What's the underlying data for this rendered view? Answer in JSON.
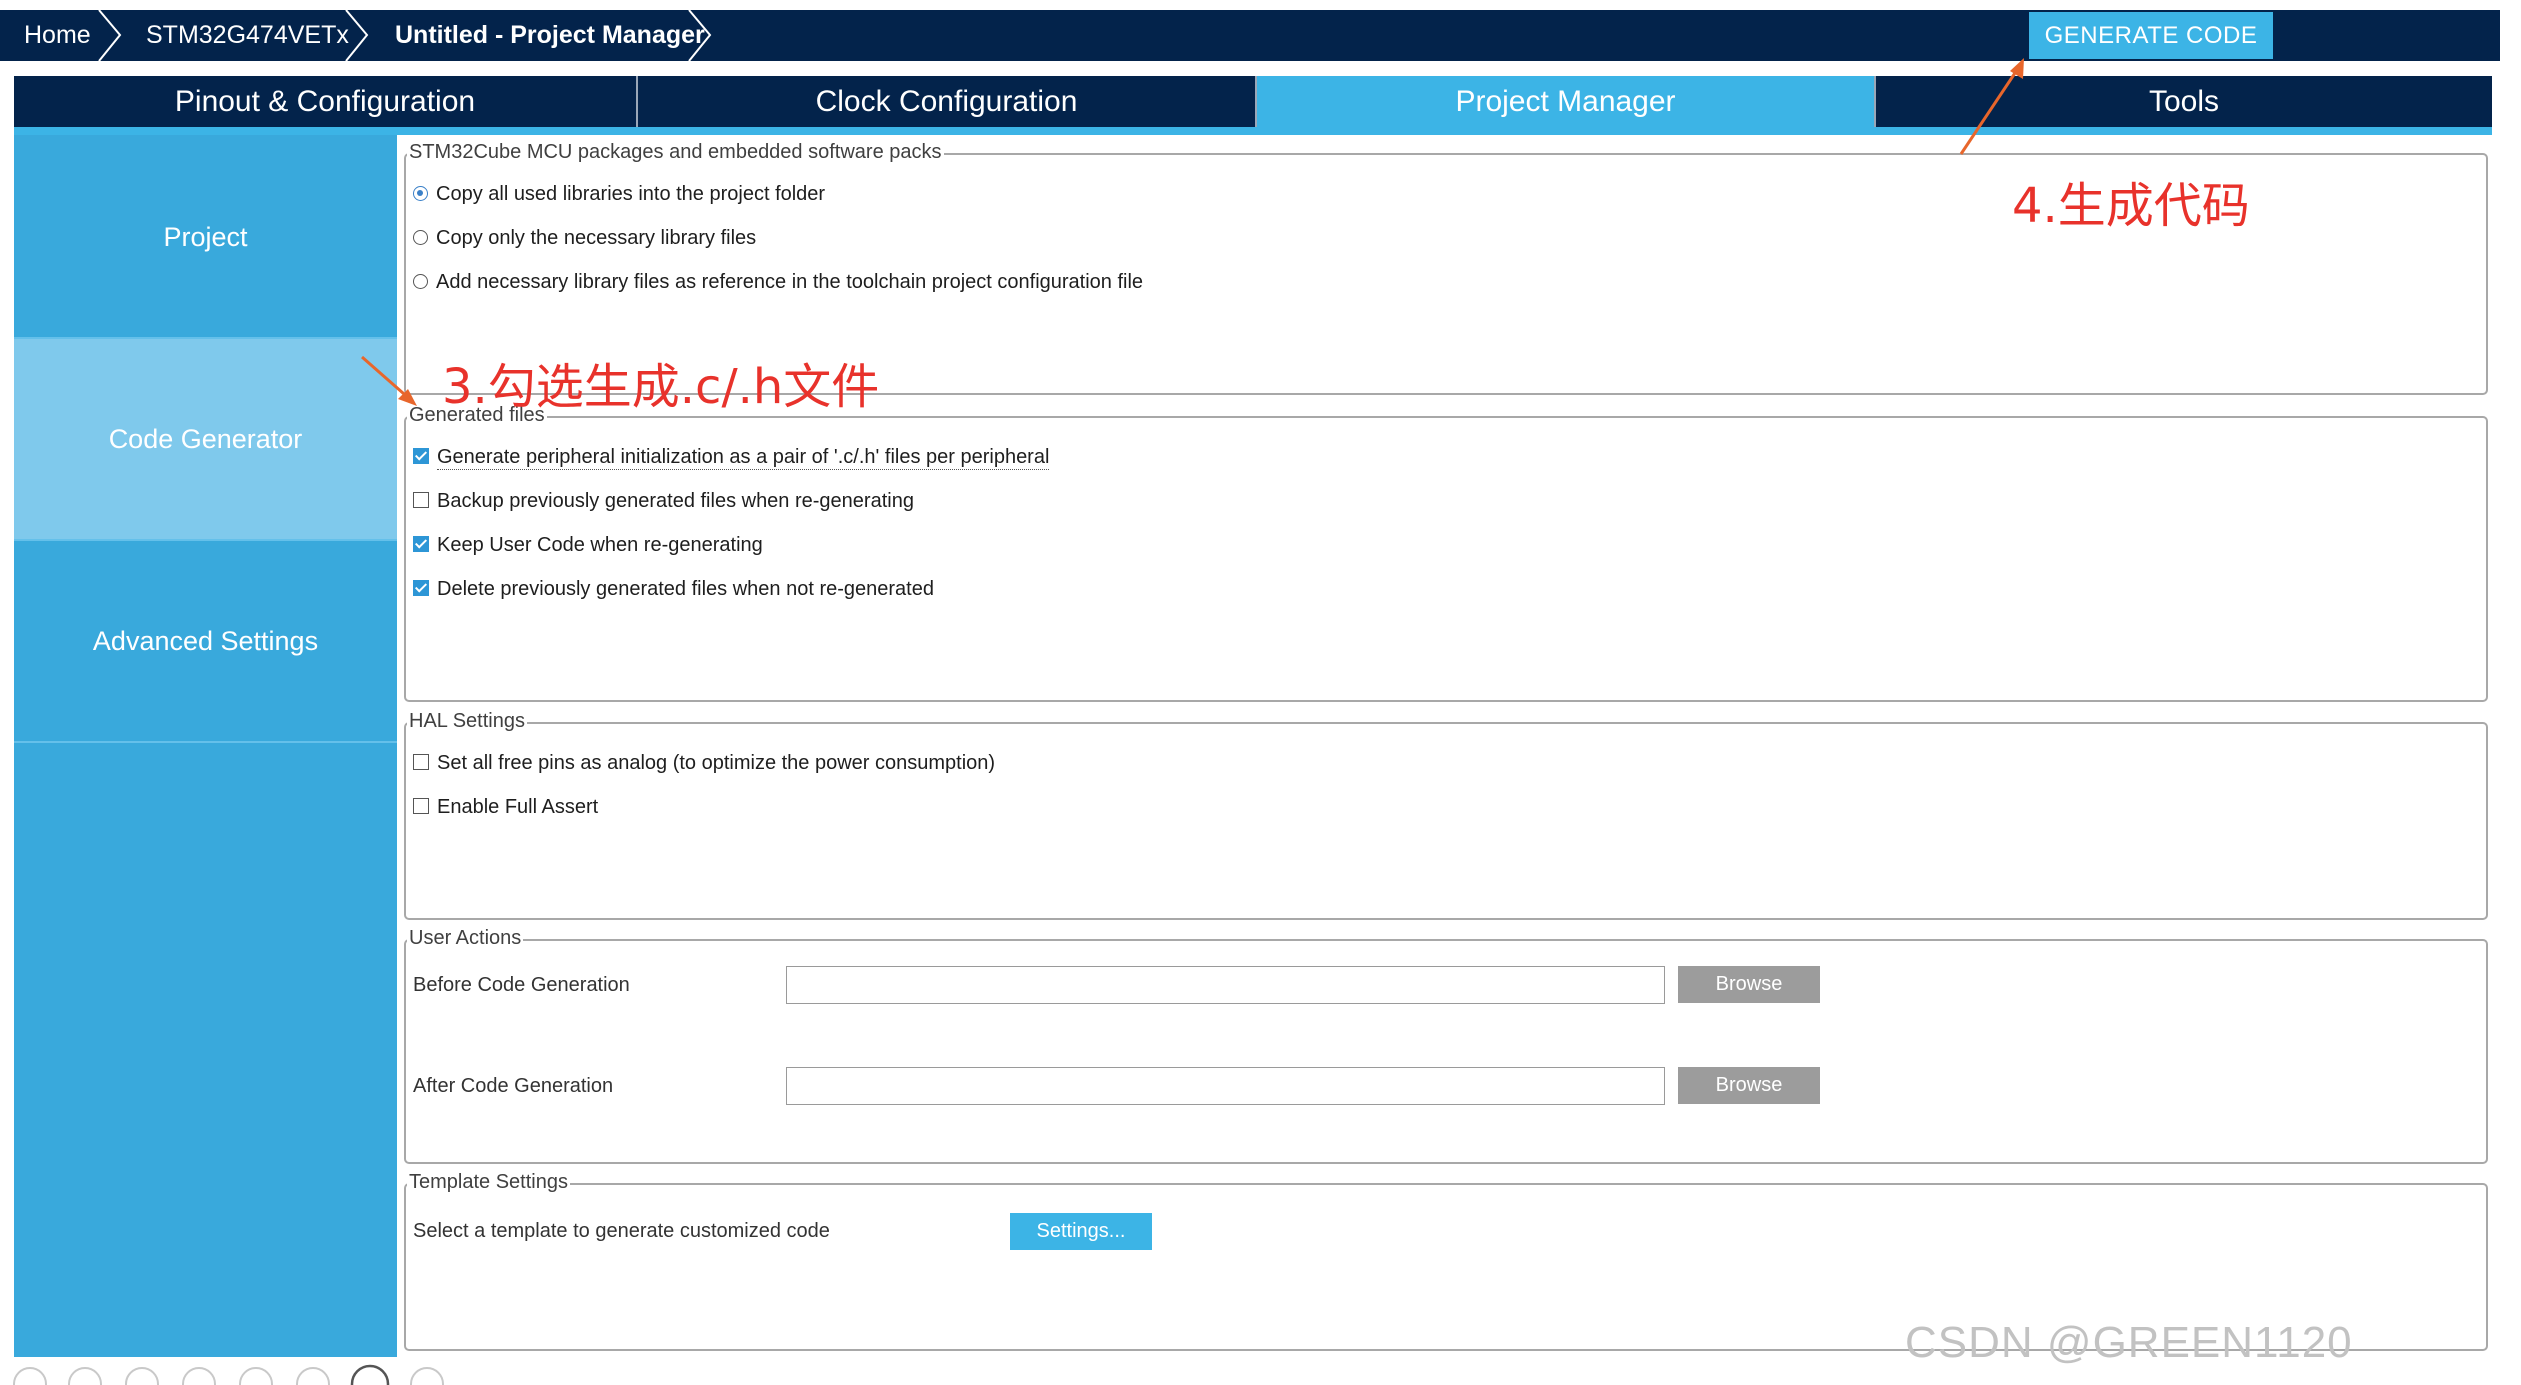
{
  "breadcrumb": {
    "home": "Home",
    "device": "STM32G474VETx",
    "project": "Untitled - Project Manager"
  },
  "generate_button": "GENERATE CODE",
  "tabs": [
    {
      "label": "Pinout & Configuration"
    },
    {
      "label": "Clock Configuration"
    },
    {
      "label": "Project Manager"
    },
    {
      "label": "Tools"
    }
  ],
  "sidenav": [
    {
      "label": "Project"
    },
    {
      "label": "Code Generator"
    },
    {
      "label": "Advanced Settings"
    }
  ],
  "packs": {
    "legend": "STM32Cube MCU packages and embedded software packs",
    "options": [
      "Copy all used libraries into the project folder",
      "Copy only the necessary library files",
      "Add necessary library files as reference in the toolchain project configuration file"
    ],
    "selected": 0
  },
  "generated_files": {
    "legend": "Generated files",
    "options": [
      {
        "label": "Generate peripheral initialization as a pair of '.c/.h' files per peripheral",
        "checked": true
      },
      {
        "label": "Backup previously generated files when re-generating",
        "checked": false
      },
      {
        "label": "Keep User Code when re-generating",
        "checked": true
      },
      {
        "label": "Delete previously generated files when not re-generated",
        "checked": true
      }
    ]
  },
  "hal": {
    "legend": "HAL Settings",
    "options": [
      {
        "label": "Set all free pins as analog (to optimize the power consumption)",
        "checked": false
      },
      {
        "label": "Enable Full Assert",
        "checked": false
      }
    ]
  },
  "user_actions": {
    "legend": "User Actions",
    "before_label": "Before Code Generation",
    "before_value": "",
    "after_label": "After Code Generation",
    "after_value": "",
    "browse": "Browse"
  },
  "template": {
    "legend": "Template Settings",
    "label": "Select a template to generate customized code",
    "button": "Settings..."
  },
  "annotations": {
    "step3": "3.勾选生成.c/.h文件",
    "step4": "4.生成代码"
  },
  "watermark": "CSDN @GREEN1120",
  "colors": {
    "navy": "#03234b",
    "accent": "#3cb4e6",
    "annotation": "#e8322b"
  }
}
